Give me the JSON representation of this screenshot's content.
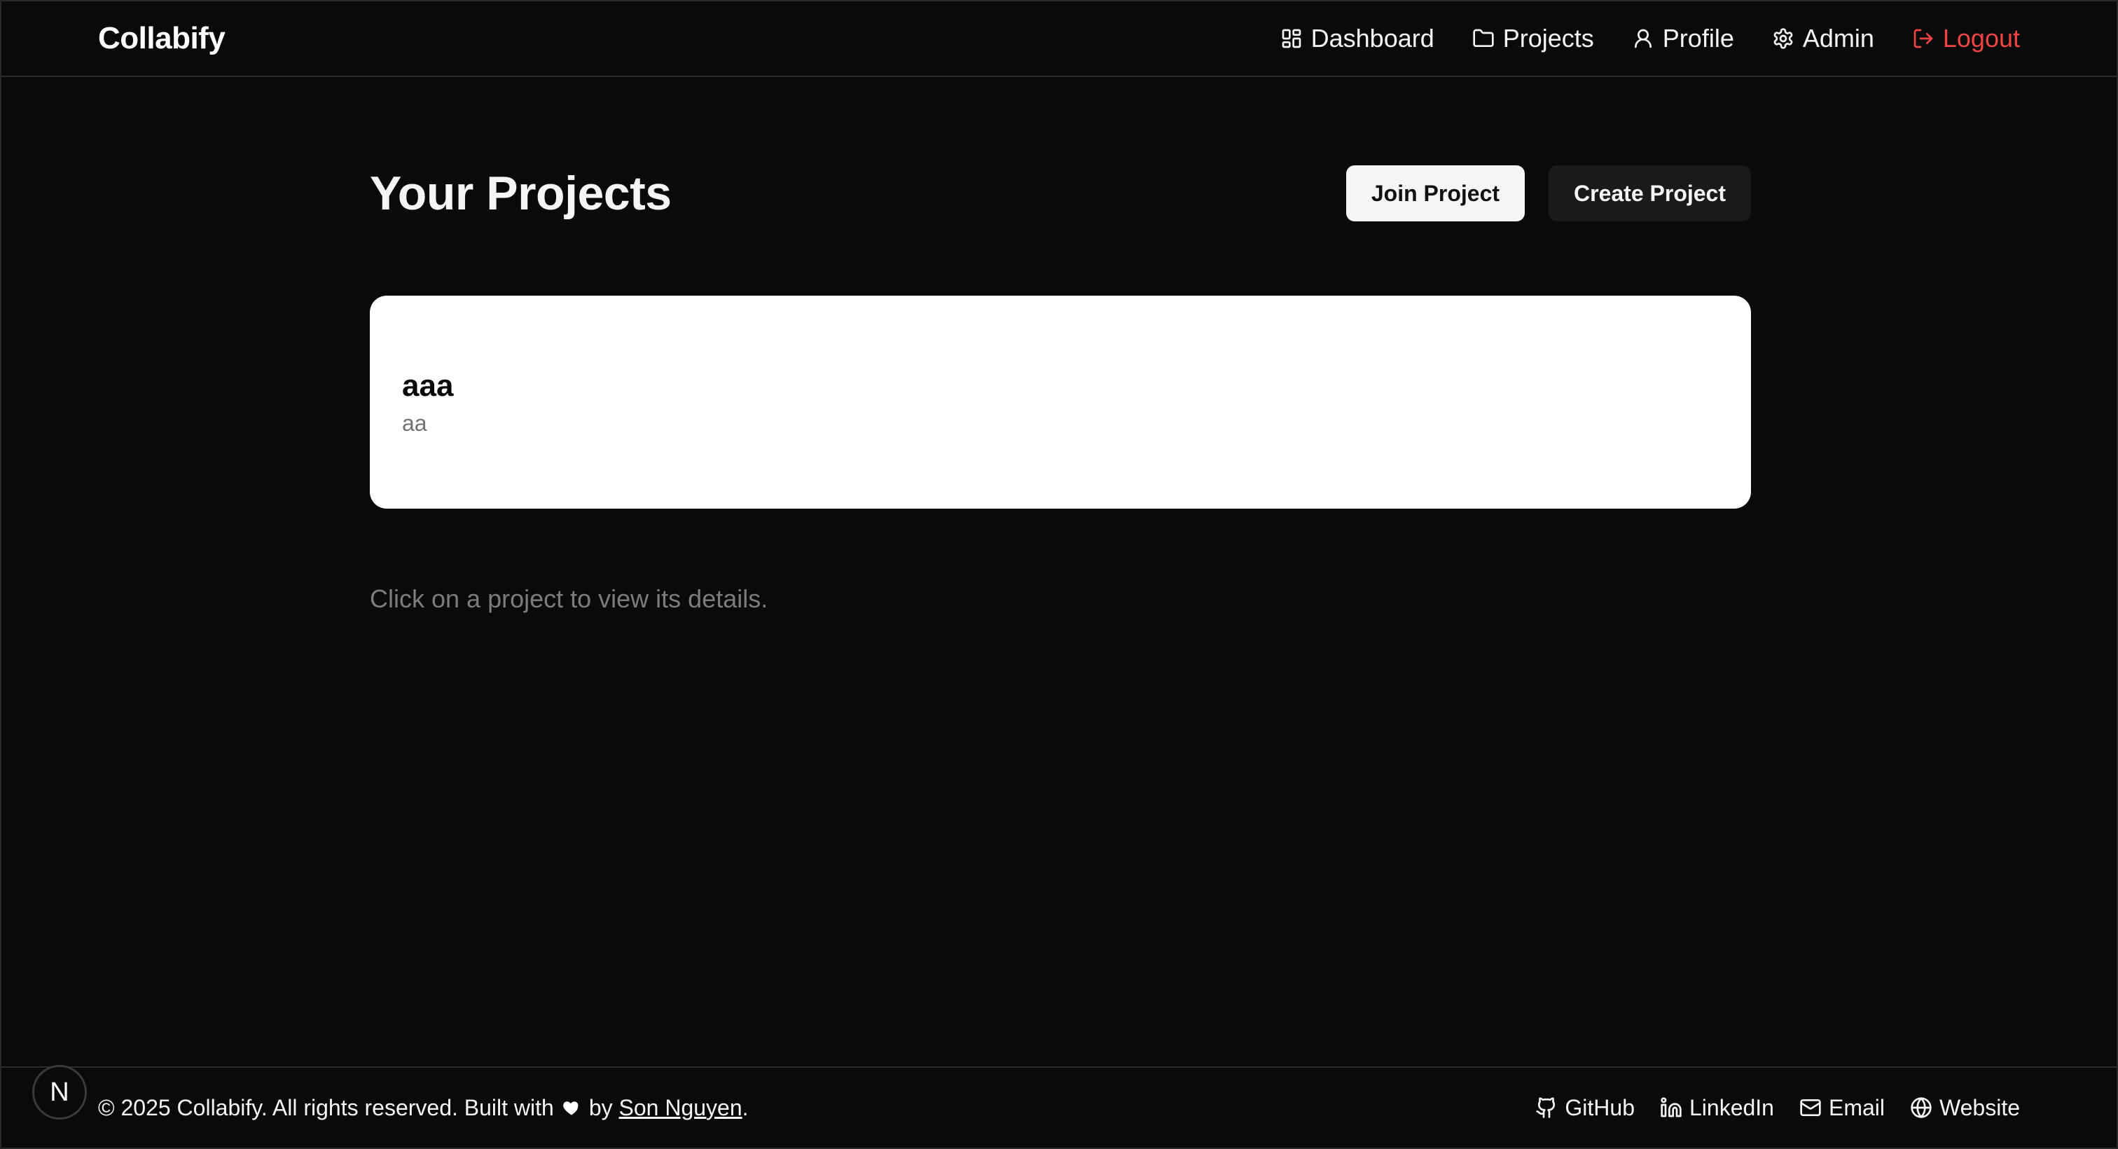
{
  "brand": "Collabify",
  "nav": {
    "dashboard": "Dashboard",
    "projects": "Projects",
    "profile": "Profile",
    "admin": "Admin",
    "logout": "Logout"
  },
  "main": {
    "title": "Your Projects",
    "join_button": "Join Project",
    "create_button": "Create Project",
    "projects": [
      {
        "name": "aaa",
        "description": "aa"
      }
    ],
    "hint": "Click on a project to view its details."
  },
  "footer": {
    "copyright_prefix": "© 2025 Collabify. All rights reserved.  Built with",
    "by": "by",
    "author": "Son Nguyen",
    "period": ".",
    "links": {
      "github": "GitHub",
      "linkedin": "LinkedIn",
      "email": "Email",
      "website": "Website"
    }
  },
  "badge": "N",
  "colors": {
    "background": "#0a0a0a",
    "logout": "#ef4444",
    "card": "#ffffff"
  }
}
